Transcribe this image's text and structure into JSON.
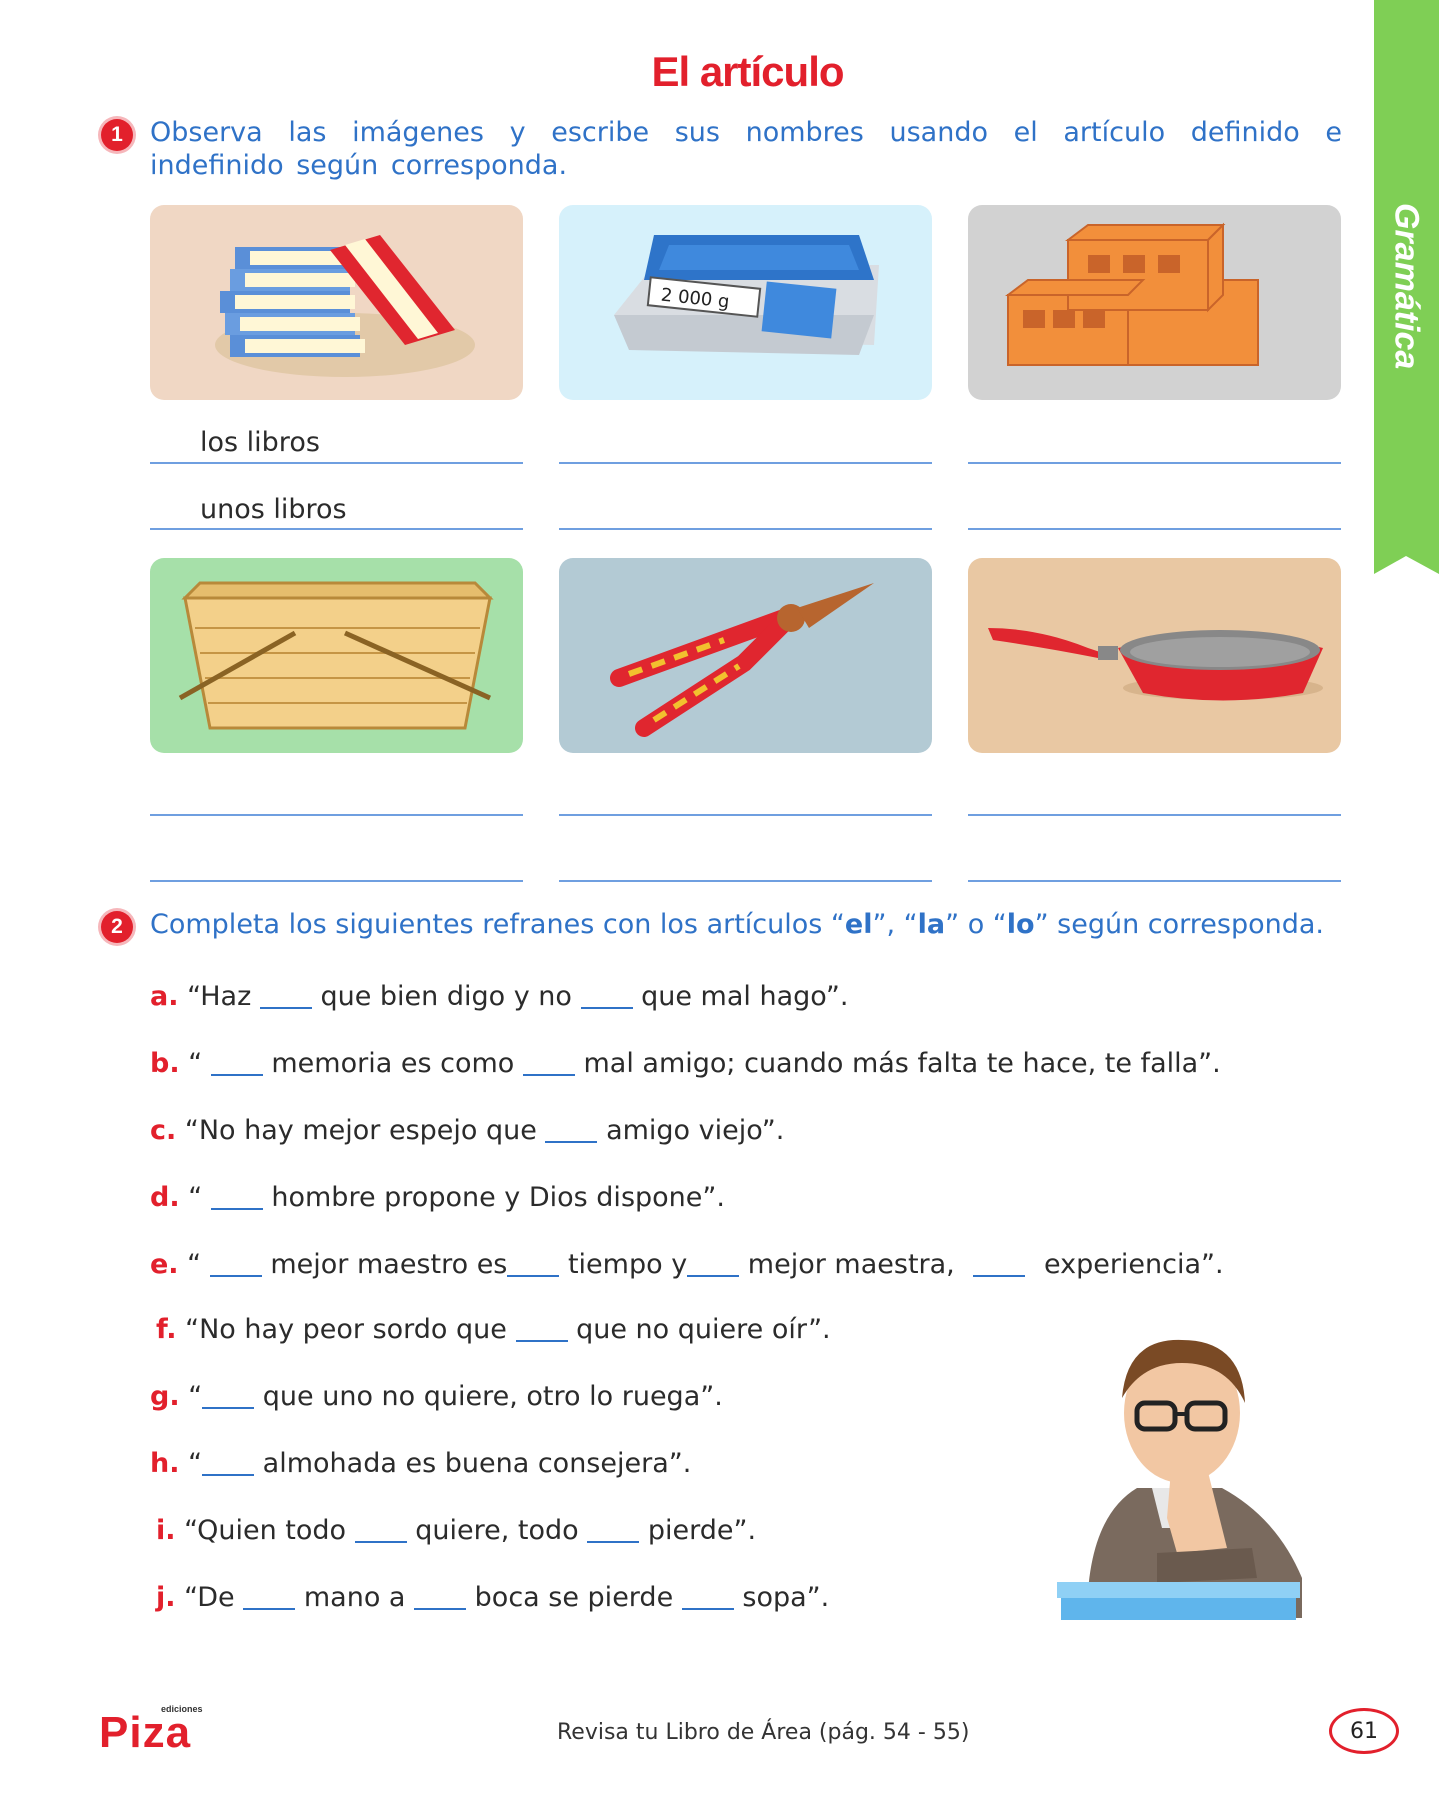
{
  "page_title": "El artículo",
  "side_tab": "Gramática",
  "exercise1": {
    "number": "1",
    "instruction": "Observa las imágenes y escribe sus nombres usando el artículo definido e indefinido según corresponda.",
    "scale_display": "2 000 g",
    "answers": {
      "first_definite": "los libros",
      "first_indefinite": "unos libros"
    }
  },
  "exercise2": {
    "number": "2",
    "instruction_pre": "Completa los siguientes refranes con los artículos “",
    "art_el": "el",
    "sep1": "”, “",
    "art_la": "la",
    "sep2": "” o “",
    "art_lo": "lo",
    "instruction_post": "” según corresponda.",
    "items": {
      "a": {
        "letter": "a.",
        "p1": "“Haz",
        "p2": "que bien digo y no",
        "p3": "que mal hago”."
      },
      "b": {
        "letter": "b.",
        "p1": "“",
        "p2": "memoria es como",
        "p3": "mal amigo; cuando más falta te hace, te falla”."
      },
      "c": {
        "letter": "c.",
        "p1": "“No hay mejor espejo que",
        "p2": "amigo viejo”."
      },
      "d": {
        "letter": "d.",
        "p1": "“",
        "p2": "hombre propone y Dios dispone”."
      },
      "e": {
        "letter": "e.",
        "p1": "“",
        "p2": "mejor maestro es",
        "p3": "tiempo y",
        "p4": "mejor maestra,",
        "p5": "experiencia”."
      },
      "f": {
        "letter": "f.",
        "p1": "“No hay peor sordo que",
        "p2": "que no quiere oír”."
      },
      "g": {
        "letter": "g.",
        "p1": "“",
        "p2": "que uno no quiere, otro lo ruega”."
      },
      "h": {
        "letter": "h.",
        "p1": "“",
        "p2": "almohada es buena consejera”."
      },
      "i": {
        "letter": "i.",
        "p1": "“Quien todo",
        "p2": "quiere, todo",
        "p3": "pierde”."
      },
      "j": {
        "letter": "j.",
        "p1": "“De",
        "p2": "mano a",
        "p3": "boca se pierde",
        "p4": "sopa”."
      }
    }
  },
  "footer": {
    "logo_small": "ediciones",
    "logo": "Piza",
    "review_note": "Revisa tu Libro de Área (pág. 54 - 55)",
    "page_number": "61"
  }
}
